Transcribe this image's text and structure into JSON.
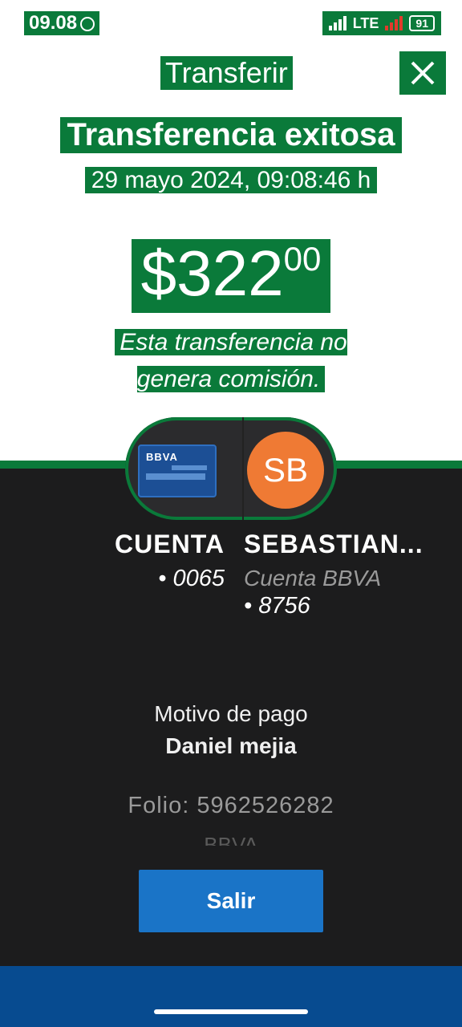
{
  "status_bar": {
    "time": "09.08",
    "network": "LTE",
    "battery": "91"
  },
  "header": {
    "title": "Transferir"
  },
  "result": {
    "title": "Transferencia exitosa",
    "datetime": "29 mayo 2024, 09:08:46 h",
    "amount_int": "$322",
    "amount_dec": "00",
    "commission_note": "Esta transferencia no genera comisión."
  },
  "from_account": {
    "card_brand": "BBVA",
    "name": "CUENTA",
    "account": "• 0065"
  },
  "to_account": {
    "initials": "SB",
    "name": "SEBASTIAN...",
    "bank": "Cuenta BBVA",
    "account": "• 8756"
  },
  "details": {
    "motivo_label": "Motivo de pago",
    "motivo_value": "Daniel mejia",
    "folio": "Folio: 5962526282",
    "partial": "BBVA"
  },
  "actions": {
    "exit_label": "Salir"
  },
  "colors": {
    "highlight_green": "#0a7a3a",
    "dark_panel": "#1c1c1d",
    "button_blue": "#1a74c7",
    "avatar_orange": "#ef7a34",
    "bottom_bar": "#074b90"
  }
}
